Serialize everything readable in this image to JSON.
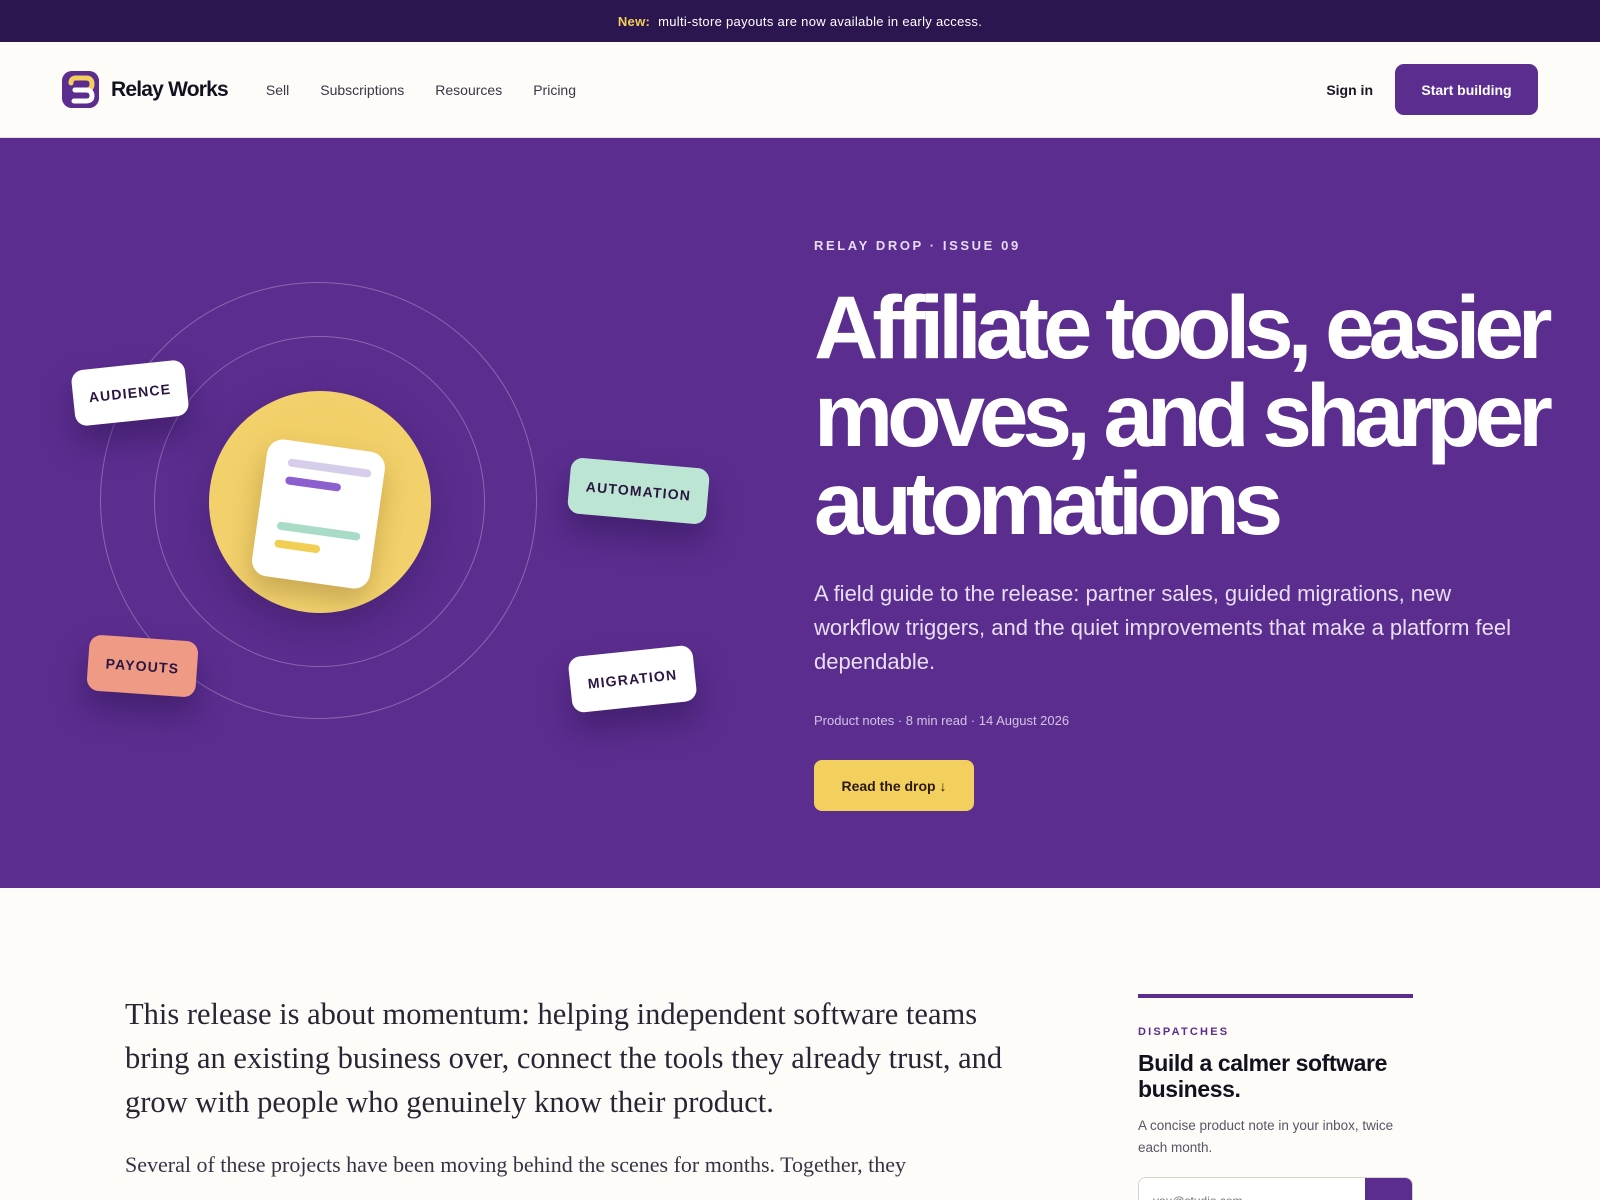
{
  "announcement": {
    "badge": "New:",
    "text": "multi-store payouts are now available in early access."
  },
  "header": {
    "brand": "Relay Works",
    "nav": [
      "Sell",
      "Subscriptions",
      "Resources",
      "Pricing"
    ],
    "sign_in": "Sign in",
    "cta": "Start building"
  },
  "hero": {
    "tags": {
      "audience": "AUDIENCE",
      "automation": "AUTOMATION",
      "payouts": "PAYOUTS",
      "migration": "MIGRATION"
    },
    "eyebrow": "RELAY DROP · ISSUE 09",
    "headline_line1": "Affiliate tools, easier",
    "headline_line2": "moves, and sharper",
    "headline_line3": "automations",
    "dek": "A field guide to the release: partner sales, guided migrations, new workflow triggers, and the quiet improvements that make a platform feel dependable.",
    "meta": "Product notes · 8 min read · 14 August 2026",
    "cta": "Read the drop ↓"
  },
  "article": {
    "lede": "This release is about momentum: helping independent software teams bring an existing business over, connect the tools they already trust, and grow with people who genuinely know their product.",
    "body": "Several of these projects have been moving behind the scenes for months. Together, they"
  },
  "dispatches": {
    "label": "DISPATCHES",
    "title": "Build a calmer software business.",
    "desc": "A concise product note in your inbox, twice each month.",
    "placeholder": "you@studio.com",
    "submit_icon": "→"
  },
  "colors": {
    "brand_purple": "#5b2d8f",
    "announce_bg": "#2b1650",
    "accent_yellow": "#f3d05e",
    "mint": "#bde5d4",
    "coral": "#ee9a85"
  }
}
